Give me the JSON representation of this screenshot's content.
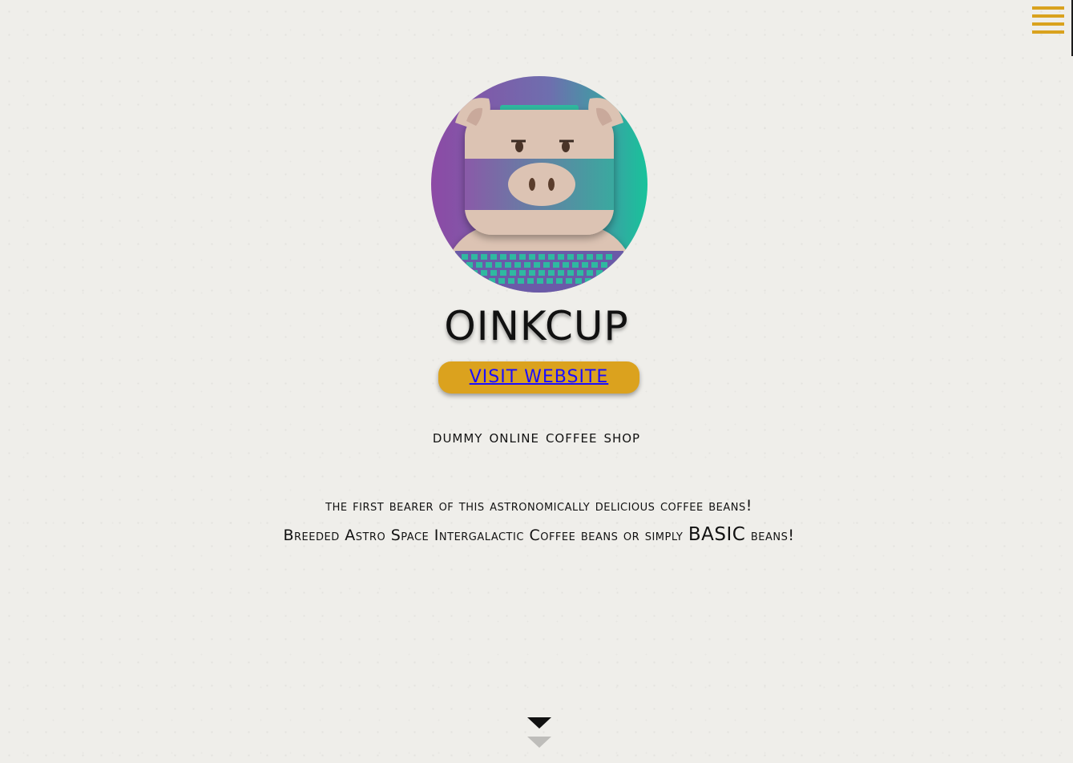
{
  "header": {
    "menu_icon": "hamburger-menu-icon",
    "menu_color": "#d9a21e"
  },
  "project": {
    "logo_icon": "pig-coffee-logo",
    "title": "OINKCUP",
    "visit_label": "VISIT WEBSITE",
    "subtitle": "DUMMY ONLINE COFFEE SHOP",
    "description_line1": "THE FIRST BEARER OF THIS ASTRONOMICALLY DELICIOUS COFFEE BEANS!",
    "description_line2a": "Breeded Astro Space Intergalactic Coffee beans or simply",
    "description_strong": "BASIC",
    "description_line2b": " beans!"
  },
  "footer": {
    "scroll_icon": "chevron-down-icon"
  },
  "colors": {
    "accent": "#dba21e",
    "link": "#1a0dff",
    "background": "#efeeea"
  }
}
